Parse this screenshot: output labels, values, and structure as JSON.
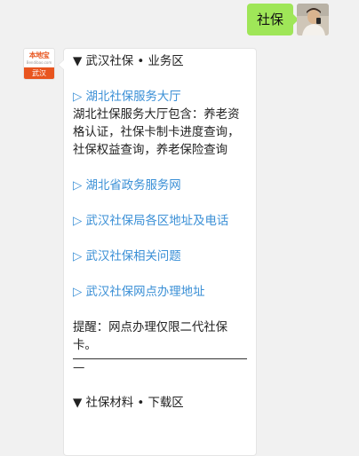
{
  "outgoing": {
    "text": "社保"
  },
  "incoming": {
    "avatar": {
      "brand_text": "本地宝",
      "site_text": "Bendibao.com",
      "city_text": "武汉"
    },
    "sections": {
      "business_heading": "▼ 武汉社保 • 业务区",
      "link_hall": "▷ 湖北社保服务大厅",
      "hall_desc": "湖北社保服务大厅包含：养老资格认证，社保卡制卡进度查询，社保权益查询，养老保险查询",
      "link_gov": "▷ 湖北省政务服务网",
      "link_address": "▷ 武汉社保局各区地址及电话",
      "link_faq": "▷ 武汉社保相关问题",
      "link_outlets": "▷ 武汉社保网点办理地址",
      "tip": "提醒：网点办理仅限二代社保卡。",
      "dash": "—",
      "download_heading": "▼ 社保材料 • 下载区"
    }
  },
  "colors": {
    "outgoing_bubble": "#9fe658",
    "link": "#3a8fd6",
    "brand_orange": "#e8551f",
    "background": "#f1f1f1"
  }
}
